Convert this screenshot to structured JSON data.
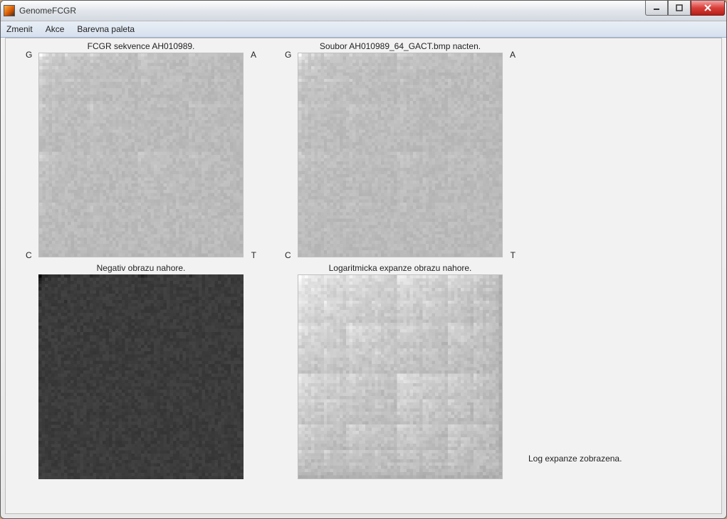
{
  "window": {
    "title": "GenomeFCGR"
  },
  "menu": {
    "items": [
      "Zmenit",
      "Akce",
      "Barevna paleta"
    ]
  },
  "controls": {
    "min": "—",
    "max": "▢",
    "close": "✕"
  },
  "panels": {
    "top_left": {
      "caption": "FCGR sekvence AH010989.",
      "corners": {
        "tl": "G",
        "tr": "A",
        "bl": "C",
        "br": "T"
      }
    },
    "top_right": {
      "caption": "Soubor AH010989_64_GACT.bmp nacten.",
      "corners": {
        "tl": "G",
        "tr": "A",
        "bl": "C",
        "br": "T"
      }
    },
    "bottom_left": {
      "caption": "Negativ obrazu nahore."
    },
    "bottom_right": {
      "caption": "Logaritmicka expanze obrazu nahore."
    }
  },
  "status": {
    "text": "Log expanze zobrazena."
  }
}
